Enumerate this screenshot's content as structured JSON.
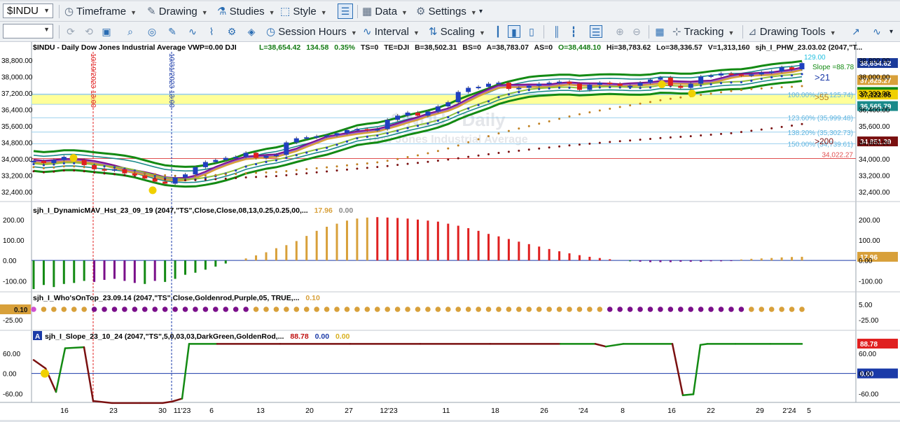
{
  "toolbar1": {
    "symbol": "$INDU",
    "timeframe": "Timeframe",
    "drawing": "Drawing",
    "studies": "Studies",
    "style": "Style",
    "data": "Data",
    "settings": "Settings"
  },
  "toolbar2": {
    "session_hours": "Session Hours",
    "interval": "Interval",
    "scaling": "Scaling",
    "tracking": "Tracking",
    "drawing_tools": "Drawing Tools"
  },
  "colors": {
    "bg": "#ffffff",
    "up_candle": "#1f3fbf",
    "down_candle": "#e02020",
    "highlight_zone": "#ffff99",
    "green_band": "#138a13",
    "goldenrod": "#d8a03a",
    "purple": "#7a0f8a",
    "dark_red": "#7a1010",
    "price_badge": "#1a3a9a"
  },
  "chart_data": [
    {
      "type": "line",
      "panel": "price",
      "header": "$INDU - Daily  Dow Jones Industrial Average  VWP=0.00  DJI",
      "header_values": [
        "L=38,654.42",
        "134.58",
        "0.35%",
        "TS=0",
        "TE=DJI",
        "B=38,502.31",
        "BS=0",
        "A=38,783.07",
        "AS=0",
        "O=38,448.10",
        "Hi=38,783.62",
        "Lo=38,336.57",
        "V=1,313,160"
      ],
      "study_header": "sjh_I_PHW_23.03.02 (2047,\"T...",
      "watermark_title": "Dow Jones Industrial Average",
      "watermark_symbol": "$INDU - Daily",
      "x_labels": [
        "16",
        "23",
        "30",
        "11'23",
        "6",
        "13",
        "20",
        "27",
        "12'23",
        "11",
        "18",
        "26",
        "'24",
        "8",
        "16",
        "22",
        "29",
        "2'24",
        "5"
      ],
      "y_ticks": [
        "38,800.00",
        "38,000.00",
        "37,200.00",
        "36,400.00",
        "35,600.00",
        "34,800.00",
        "34,000.00",
        "33,200.00",
        "32,400.00"
      ],
      "ylim": [
        32000,
        39200
      ],
      "vertical_markers": [
        "10/19/2023 13:00",
        "10/31/2023 13:00"
      ],
      "fib_labels": [
        "100.00% (37,125.74)",
        "123.60% (35,999.48)",
        "138.20% (35,302.73)",
        "150.00% (34,739.61)"
      ],
      "fib_values": [
        37125.74,
        35999.48,
        35302.73,
        34739.61
      ],
      "support_line": {
        "label": "34,022.27",
        "value": 34022.27
      },
      "annotations": [
        "129.00",
        "Slope =88.78",
        ">21",
        ">55",
        ">200"
      ],
      "right_badges": [
        "38,654.62",
        "37,825.27",
        "37,250.89",
        "37,122.95",
        "36,565.79",
        "34,851.39"
      ],
      "highlight_zone": [
        36650,
        37150
      ],
      "closes": [
        33900,
        33800,
        33950,
        34100,
        33950,
        33700,
        33500,
        33450,
        33500,
        33300,
        33200,
        33050,
        32900,
        32800,
        33100,
        33250,
        33600,
        33850,
        33950,
        34050,
        34100,
        34300,
        34050,
        34150,
        34200,
        34800,
        35000,
        35050,
        35100,
        35150,
        35250,
        35400,
        35450,
        35400,
        35450,
        35900,
        36100,
        36250,
        36100,
        36300,
        36550,
        36750,
        37250,
        37450,
        37500,
        37650,
        37700,
        37400,
        37450,
        37550,
        37650,
        37700,
        37750,
        37650,
        37350,
        37600,
        37700,
        37650,
        37550,
        37550,
        37700,
        37850,
        37950,
        37550,
        37450,
        37650,
        38000,
        38050,
        38150,
        38100,
        38050,
        38100,
        38200,
        38250,
        38450,
        38350,
        38650
      ]
    },
    {
      "type": "bar",
      "panel": "histogram",
      "header": "sjh_I_DynamicMAV_Hst_23_09_19 (2047,\"TS\",Close,Close,08,13,0.25,0.25,00,...",
      "header_values": [
        "17.96",
        "0.00"
      ],
      "y_ticks": [
        "200.00",
        "100.00",
        "0.00",
        "-100.00"
      ],
      "ylim": [
        -150,
        230
      ],
      "last_value": "17.96",
      "values": [
        -140,
        -120,
        -130,
        -115,
        -110,
        -100,
        -105,
        -95,
        -90,
        -100,
        -110,
        -115,
        -100,
        -105,
        -90,
        -70,
        -60,
        -45,
        -30,
        -15,
        0,
        10,
        25,
        40,
        60,
        75,
        95,
        120,
        145,
        165,
        180,
        195,
        205,
        210,
        212,
        210,
        208,
        205,
        200,
        195,
        190,
        180,
        170,
        158,
        145,
        130,
        118,
        105,
        92,
        80,
        68,
        56,
        45,
        35,
        26,
        18,
        12,
        6,
        0,
        -4,
        -6,
        -8,
        -8,
        -8,
        -6,
        -6,
        -6,
        -4,
        -4,
        -3,
        5,
        8,
        10,
        12,
        15,
        17,
        18
      ],
      "colors": [
        "green",
        "green",
        "green",
        "green",
        "green",
        "green",
        "purple",
        "purple",
        "purple",
        "purple",
        "purple",
        "green",
        "purple",
        "green",
        "green",
        "green",
        "green",
        "green",
        "green",
        "green",
        "green",
        "goldenrod",
        "goldenrod",
        "goldenrod",
        "goldenrod",
        "goldenrod",
        "goldenrod",
        "goldenrod",
        "goldenrod",
        "goldenrod",
        "goldenrod",
        "goldenrod",
        "goldenrod",
        "goldenrod",
        "red",
        "red",
        "red",
        "red",
        "red",
        "red",
        "red",
        "red",
        "red",
        "red",
        "red",
        "red",
        "red",
        "red",
        "red",
        "red",
        "red",
        "red",
        "red",
        "red",
        "red",
        "red",
        "red",
        "red",
        "red",
        "green",
        "purple",
        "purple",
        "purple",
        "purple",
        "purple",
        "purple",
        "purple",
        "purple",
        "purple",
        "purple",
        "goldenrod",
        "goldenrod",
        "goldenrod",
        "goldenrod",
        "goldenrod",
        "goldenrod",
        "goldenrod"
      ]
    },
    {
      "type": "scatter",
      "panel": "dots",
      "header": "sjh_I_Who'sOnTop_23.09.14 (2047,\"TS\",Close,Goldenrod,Purple,05,  TRUE,...",
      "header_values": [
        "0.10"
      ],
      "y_ticks": [
        "5.00",
        "-25.00"
      ],
      "left_badge": "0.10",
      "dot_colors": [
        "magenta",
        "goldenrod",
        "goldenrod",
        "goldenrod",
        "goldenrod",
        "goldenrod",
        "purple",
        "purple",
        "purple",
        "purple",
        "purple",
        "purple",
        "purple",
        "purple",
        "purple",
        "purple",
        "purple",
        "purple",
        "purple",
        "purple",
        "purple",
        "purple",
        "goldenrod",
        "goldenrod",
        "goldenrod",
        "goldenrod",
        "goldenrod",
        "goldenrod",
        "goldenrod",
        "goldenrod",
        "goldenrod",
        "goldenrod",
        "goldenrod",
        "goldenrod",
        "goldenrod",
        "goldenrod",
        "goldenrod",
        "goldenrod",
        "goldenrod",
        "goldenrod",
        "goldenrod",
        "goldenrod",
        "goldenrod",
        "goldenrod",
        "goldenrod",
        "goldenrod",
        "goldenrod",
        "goldenrod",
        "goldenrod",
        "goldenrod",
        "goldenrod",
        "goldenrod",
        "goldenrod",
        "goldenrod",
        "goldenrod",
        "goldenrod",
        "goldenrod",
        "purple",
        "purple",
        "purple",
        "purple",
        "purple",
        "purple",
        "purple",
        "purple",
        "purple",
        "purple",
        "purple",
        "purple",
        "purple",
        "purple",
        "goldenrod",
        "goldenrod",
        "goldenrod",
        "goldenrod",
        "goldenrod",
        "goldenrod"
      ]
    },
    {
      "type": "line",
      "panel": "slope",
      "header": "sjh_I_Slope_23_10_24 (2047,\"TS\",5,0,03,03,DarkGreen,GoldenRod,...",
      "header_values": [
        "88.78",
        "0.00",
        "0.00"
      ],
      "y_ticks": [
        "60.00",
        "0.00",
        "-60.00"
      ],
      "ylim": [
        -80,
        95
      ],
      "right_badges": [
        "88.78",
        "0.00"
      ],
      "x": [
        48,
        65,
        80,
        93,
        120,
        133,
        160,
        200,
        232,
        245,
        260,
        270,
        310,
        400,
        500,
        600,
        700,
        800,
        850,
        865,
        890,
        960,
        975,
        990,
        1000,
        1010,
        1050,
        1100,
        1145
      ],
      "values": [
        40,
        15,
        -55,
        75,
        78,
        -82,
        -88,
        -88,
        -88,
        -84,
        -75,
        88,
        88,
        88,
        88,
        88,
        88,
        88,
        88,
        80,
        88,
        88,
        -65,
        -62,
        85,
        88,
        88,
        88,
        88
      ],
      "segment_colors": [
        "dark_red",
        "dark_red",
        "green",
        "green",
        "dark_red",
        "dark_red",
        "dark_red",
        "dark_red",
        "dark_red",
        "dark_red",
        "green",
        "green",
        "dark_red",
        "dark_red",
        "dark_red",
        "dark_red",
        "dark_red",
        "green",
        "dark_red",
        "green",
        "green",
        "dark_red",
        "green",
        "green",
        "green",
        "green",
        "green",
        "green"
      ]
    }
  ]
}
